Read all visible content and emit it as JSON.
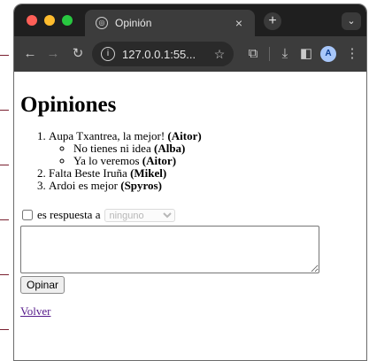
{
  "browser": {
    "tab_title": "Opinión",
    "tab_close": "×",
    "new_tab": "+",
    "tab_menu": "⌄",
    "url": "127.0.0.1:55...",
    "profile_initial": "A",
    "icons": [
      "back-icon",
      "forward-icon",
      "reload-icon",
      "info-icon",
      "star-icon",
      "extensions-icon",
      "download-icon",
      "side-panel-icon",
      "menu-icon"
    ]
  },
  "page": {
    "heading": "Opiniones",
    "opinions": [
      {
        "text": "Aupa Txantrea, la mejor! ",
        "author": "(Aitor)",
        "replies": [
          {
            "text": "No tienes ni idea ",
            "author": "(Alba)"
          },
          {
            "text": "Ya lo veremos ",
            "author": "(Aitor)"
          }
        ]
      },
      {
        "text": "Falta Beste Iruña ",
        "author": "(Mikel)",
        "replies": []
      },
      {
        "text": "Ardoi es mejor ",
        "author": "(Spyros)",
        "replies": []
      }
    ],
    "form": {
      "reply_label": "es respuesta a",
      "reply_select_value": "ninguno",
      "textarea_value": "",
      "submit_label": "Opinar"
    },
    "back_link": "Volver"
  }
}
